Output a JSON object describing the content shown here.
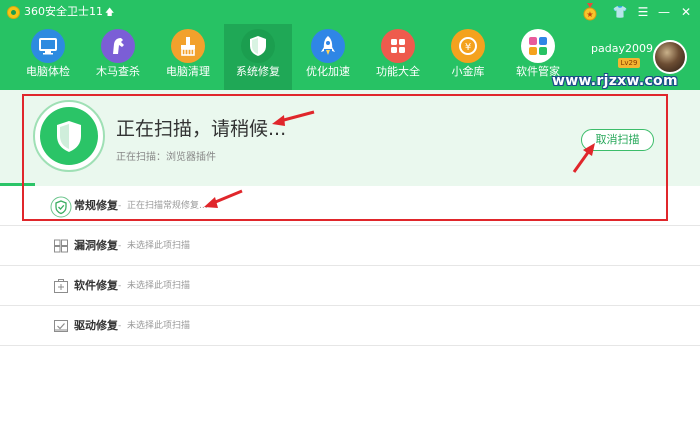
{
  "app": {
    "title": "360安全卫士11",
    "title_arrow": "🡅"
  },
  "window_controls": {
    "medal_icon": "medal-icon",
    "skin": "👕",
    "menu": "☰",
    "minimize": "—",
    "close": "✕"
  },
  "nav": {
    "items": [
      {
        "label": "电脑体检",
        "icon": "monitor-icon",
        "color": "#2d8be0"
      },
      {
        "label": "木马查杀",
        "icon": "horse-icon",
        "color": "#7b5ed6"
      },
      {
        "label": "电脑清理",
        "icon": "broom-icon",
        "color": "#f2a12c"
      },
      {
        "label": "系统修复",
        "icon": "shield-icon",
        "color": "#1b9e4f"
      },
      {
        "label": "优化加速",
        "icon": "rocket-icon",
        "color": "#2f86e6"
      },
      {
        "label": "功能大全",
        "icon": "grid-icon",
        "color": "#ee5b4d"
      },
      {
        "label": "小金库",
        "icon": "coin-icon",
        "color": "#f4a21e"
      },
      {
        "label": "软件管家",
        "icon": "apps-icon",
        "color": "#e85a9b"
      }
    ],
    "active_index": 3
  },
  "user": {
    "name": "paday2009",
    "level": "Lv29"
  },
  "watermark": "www.rjzxw.com",
  "scan": {
    "title": "正在扫描，请稍候...",
    "subtitle": "正在扫描：浏览器插件",
    "cancel_label": "取消扫描",
    "progress_fraction": 0.05
  },
  "repairs": [
    {
      "title": "常规修复",
      "sep": "-",
      "status": "正在扫描常规修复...",
      "icon": "shield-scan-icon"
    },
    {
      "title": "漏洞修复",
      "sep": "-",
      "status": "未选择此项扫描",
      "icon": "windows-icon"
    },
    {
      "title": "软件修复",
      "sep": "-",
      "status": "未选择此项扫描",
      "icon": "software-box-icon"
    },
    {
      "title": "驱动修复",
      "sep": "-",
      "status": "未选择此项扫描",
      "icon": "driver-icon"
    }
  ],
  "colors": {
    "brand_green": "#27c264",
    "active_tab": "#1fa856",
    "annotation_red": "#e0262b"
  }
}
